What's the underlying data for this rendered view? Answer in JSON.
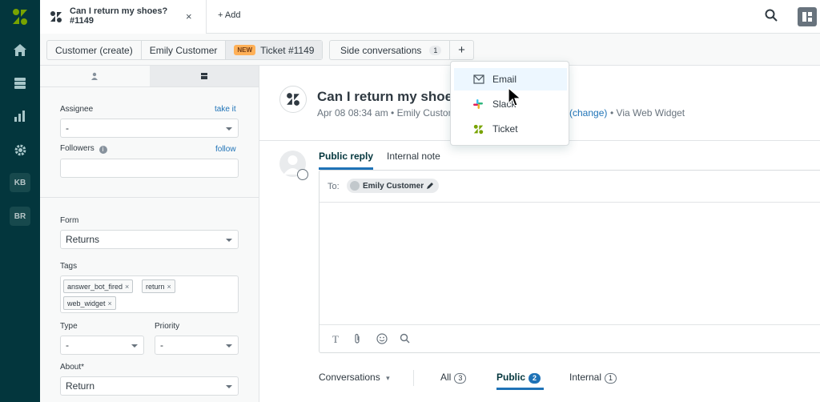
{
  "topbar": {
    "ticket_tab_title": "Can I return my shoes? #1149",
    "close_glyph": "×",
    "add_label": "+ Add",
    "icons": [
      "zendesk-logo-icon",
      "search-icon",
      "apps-icon"
    ]
  },
  "nav": {
    "icons": [
      "home-icon",
      "views-icon",
      "reporting-icon",
      "admin-gear-icon"
    ],
    "badges": [
      "KB",
      "BR"
    ]
  },
  "breadcrumb": {
    "items": [
      "Customer (create)",
      "Emily Customer",
      "Ticket #1149"
    ],
    "new_badge": "NEW",
    "side_conversations_label": "Side conversations",
    "side_conversations_count": "1",
    "plus_label": "+"
  },
  "left_panel": {
    "assignee_label": "Assignee",
    "take_it_link": "take it",
    "assignee_value": "-",
    "followers_label": "Followers",
    "follow_link": "follow",
    "followers_value": "",
    "form_label": "Form",
    "form_value": "Returns",
    "tags_label": "Tags",
    "tags": [
      "answer_bot_fired",
      "return",
      "web_widget"
    ],
    "tag_remove_glyph": "×",
    "type_label": "Type",
    "type_value": "-",
    "priority_label": "Priority",
    "priority_value": "-",
    "about_label": "About*",
    "about_value": "Return"
  },
  "main": {
    "title": "Can I return my shoes?",
    "meta": "Apr 08 08:34 am • Emily Customer",
    "change_link": "(change)",
    "via": "• Via Web Widget",
    "reply_tabs": [
      "Public reply",
      "Internal note"
    ],
    "to_label": "To:",
    "to_recipient": "Emily Customer",
    "composer_text": "",
    "toolbar_icons": [
      "text-format-icon",
      "attachment-icon",
      "emoji-icon",
      "search-icon"
    ],
    "conversations_label": "Conversations",
    "conv_tabs": [
      {
        "label": "All",
        "count": "3"
      },
      {
        "label": "Public",
        "count": "2"
      },
      {
        "label": "Internal",
        "count": "1"
      }
    ]
  },
  "side_conv_menu": {
    "items": [
      "Email",
      "Slack",
      "Ticket"
    ],
    "highlighted": "Email"
  },
  "colors": {
    "nav_bg": "#03363d",
    "accent_blue": "#1f73b7",
    "new_badge": "#ffb057",
    "brand_green": "#78a300"
  }
}
